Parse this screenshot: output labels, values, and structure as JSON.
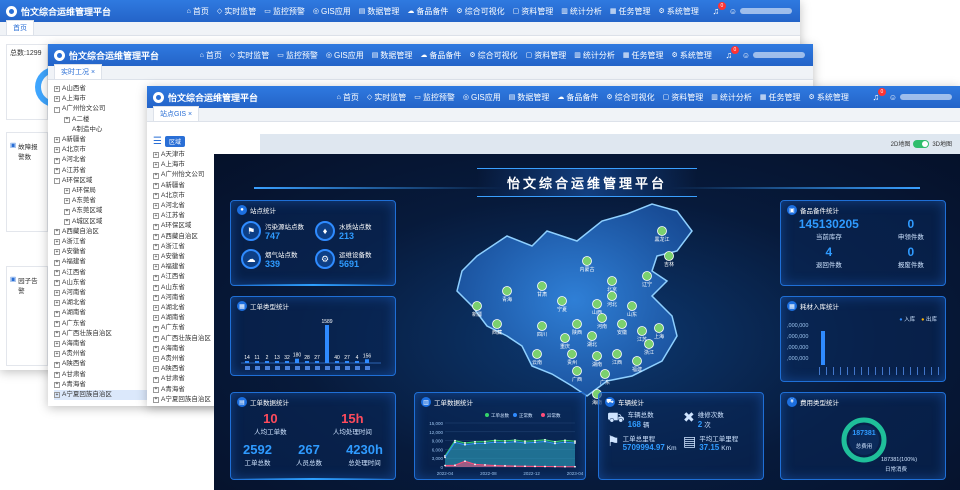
{
  "app_title": "怡文综合运维管理平台",
  "menu": [
    {
      "icon": "home-icon",
      "glyph": "⌂",
      "label": "首页"
    },
    {
      "icon": "shield-icon",
      "glyph": "◇",
      "label": "实时监管"
    },
    {
      "icon": "monitor-icon",
      "glyph": "▭",
      "label": "监控预警"
    },
    {
      "icon": "globe-icon",
      "glyph": "◎",
      "label": "GIS应用"
    },
    {
      "icon": "database-icon",
      "glyph": "▤",
      "label": "数据管理"
    },
    {
      "icon": "cloud-icon",
      "glyph": "☁",
      "label": "备品备件"
    },
    {
      "icon": "share-icon",
      "glyph": "⚙",
      "label": "综合可视化"
    },
    {
      "icon": "document-icon",
      "glyph": "▢",
      "label": "资料管理"
    },
    {
      "icon": "chart-icon",
      "glyph": "▥",
      "label": "统计分析"
    },
    {
      "icon": "task-icon",
      "glyph": "▦",
      "label": "任务管理"
    },
    {
      "icon": "gear-icon",
      "glyph": "⚙",
      "label": "系统管理"
    }
  ],
  "bell_count": "0",
  "win1": {
    "tab": "首页",
    "total_label": "总数:1299",
    "alarm_label": "故障报警数",
    "gas_label": "园子告警"
  },
  "win2": {
    "tab": "实时工况",
    "tree": [
      {
        "t": "A山西省",
        "b": "+",
        "d": 0
      },
      {
        "t": "A上海市",
        "b": "+",
        "d": 0
      },
      {
        "t": "A广州怡文公司",
        "b": "-",
        "d": 0
      },
      {
        "t": "A二楼",
        "b": "+",
        "d": 1
      },
      {
        "t": "A制造中心",
        "b": "",
        "d": 1
      },
      {
        "t": "A新疆省",
        "b": "+",
        "d": 0
      },
      {
        "t": "A北京市",
        "b": "+",
        "d": 0
      },
      {
        "t": "A河北省",
        "b": "+",
        "d": 0
      },
      {
        "t": "A江苏省",
        "b": "+",
        "d": 0
      },
      {
        "t": "A环保区域",
        "b": "-",
        "d": 0
      },
      {
        "t": "A环保局",
        "b": "+",
        "d": 1
      },
      {
        "t": "A东莞省",
        "b": "+",
        "d": 1
      },
      {
        "t": "A东莞区域",
        "b": "+",
        "d": 1
      },
      {
        "t": "A城区区域",
        "b": "+",
        "d": 1
      },
      {
        "t": "A西藏自治区",
        "b": "+",
        "d": 0
      },
      {
        "t": "A浙江省",
        "b": "+",
        "d": 0
      },
      {
        "t": "A安徽省",
        "b": "+",
        "d": 0
      },
      {
        "t": "A福建省",
        "b": "+",
        "d": 0
      },
      {
        "t": "A江西省",
        "b": "+",
        "d": 0
      },
      {
        "t": "A山东省",
        "b": "+",
        "d": 0
      },
      {
        "t": "A河南省",
        "b": "+",
        "d": 0
      },
      {
        "t": "A湖北省",
        "b": "+",
        "d": 0
      },
      {
        "t": "A湖南省",
        "b": "+",
        "d": 0
      },
      {
        "t": "A广东省",
        "b": "+",
        "d": 0
      },
      {
        "t": "A广西壮族自治区",
        "b": "+",
        "d": 0
      },
      {
        "t": "A海南省",
        "b": "+",
        "d": 0
      },
      {
        "t": "A贵州省",
        "b": "+",
        "d": 0
      },
      {
        "t": "A陕西省",
        "b": "+",
        "d": 0
      },
      {
        "t": "A甘肃省",
        "b": "+",
        "d": 0
      },
      {
        "t": "A青海省",
        "b": "+",
        "d": 0
      },
      {
        "t": "A宁夏回族自治区",
        "b": "+",
        "d": 0
      }
    ]
  },
  "win3": {
    "tab": "站点GIS",
    "region_btn": "区域",
    "map2d_label": "2D地图",
    "map3d_label": "3D地图",
    "tree": [
      "A天津市",
      "A上海市",
      "A广州怡文公司",
      "A新疆省",
      "A北京市",
      "A河北省",
      "A江苏省",
      "A环保区域",
      "A西藏自治区",
      "A浙江省",
      "A安徽省",
      "A福建省",
      "A江西省",
      "A山东省",
      "A河南省",
      "A湖北省",
      "A湖南省",
      "A广东省",
      "A广西壮族自治区",
      "A海南省",
      "A贵州省",
      "A陕西省",
      "A甘肃省",
      "A青海省",
      "A宁夏回族自治区"
    ]
  },
  "dashboard": {
    "title": "怡文综合运维管理平台",
    "site_panel": {
      "title": "站点统计",
      "items": [
        {
          "label": "污染源站点数",
          "value": "747"
        },
        {
          "label": "水质站点数",
          "value": "213"
        },
        {
          "label": "烟气站点数",
          "value": "339"
        },
        {
          "label": "运维设备数",
          "value": "5691"
        }
      ]
    },
    "type_panel": {
      "title": "工单类型统计"
    },
    "order_panel": {
      "title": "工单数据统计",
      "items": [
        {
          "value": "10",
          "label": "人均工单数",
          "color": "red"
        },
        {
          "value": "15h",
          "label": "人均处理时间",
          "color": "red"
        },
        {
          "value": "2592",
          "label": "工单总数",
          "color": "blue"
        },
        {
          "value": "267",
          "label": "人员总数",
          "color": "blue"
        },
        {
          "value": "4230h",
          "label": "总处理时间",
          "color": "blue"
        }
      ]
    },
    "trend_panel": {
      "title": "工单数据统计"
    },
    "vehicle_panel": {
      "title": "车辆统计",
      "items": [
        {
          "label": "车辆总数",
          "value": "168",
          "unit": "辆"
        },
        {
          "label": "维修次数",
          "value": "2",
          "unit": "次"
        },
        {
          "label": "工单总里程",
          "value": "5709994.97",
          "unit": "Km"
        },
        {
          "label": "平均工单里程",
          "value": "37.15",
          "unit": "Km"
        }
      ]
    },
    "spare_panel": {
      "title": "备品备件统计",
      "items": [
        {
          "value": "145130205",
          "label": "当前库存"
        },
        {
          "value": "0",
          "label": "申领件数"
        },
        {
          "value": "4",
          "label": "退回件数"
        },
        {
          "value": "0",
          "label": "报废件数"
        }
      ]
    },
    "inout_panel": {
      "title": "耗材入库统计",
      "legend": [
        "入库",
        "出库"
      ],
      "ticks": [
        ",000,000",
        ",000,000",
        ",000,000",
        ",000,000"
      ]
    },
    "cost_panel": {
      "title": "费用类型统计",
      "value": "187381",
      "sub": "总费用",
      "pct": "187381(100%)",
      "cat": "日常消费"
    },
    "map_labels": [
      "新疆",
      "西藏",
      "青海",
      "甘肃",
      "内蒙古",
      "黑龙江",
      "吉林",
      "辽宁",
      "北京",
      "河北",
      "山西",
      "山东",
      "河南",
      "陕西",
      "四川",
      "重庆",
      "湖北",
      "安徽",
      "江苏",
      "上海",
      "浙江",
      "湖南",
      "江西",
      "福建",
      "贵州",
      "云南",
      "广西",
      "广东",
      "海南",
      "宁夏"
    ]
  },
  "chart_data": [
    {
      "type": "bar",
      "title": "工单类型统计",
      "values": [
        14,
        11,
        2,
        13,
        32,
        180,
        28,
        27,
        1589,
        40,
        27,
        4,
        156
      ]
    },
    {
      "type": "area",
      "title": "工单数据统计",
      "x": [
        "2022-04",
        "2022-08",
        "2022-12",
        "2023-04"
      ],
      "ylim": [
        0,
        15000
      ],
      "yticks": [
        "15,000",
        "12,000",
        "9,000",
        "6,000",
        "3,000",
        "0"
      ],
      "series": [
        {
          "name": "工单总数",
          "color": "#35d46a",
          "values": [
            3800,
            9000,
            8200,
            8600,
            8700,
            9100,
            8900,
            9200,
            8800,
            9000,
            9300,
            8600,
            9100,
            8800
          ]
        },
        {
          "name": "正常数",
          "color": "#2f8bff",
          "values": [
            3300,
            8400,
            7600,
            8000,
            8100,
            8500,
            8300,
            8600,
            8200,
            8400,
            8700,
            8000,
            8500,
            8200
          ]
        },
        {
          "name": "异常数",
          "color": "#ff4d7a",
          "values": [
            500,
            600,
            2000,
            900,
            700,
            500,
            400,
            300,
            250,
            200,
            150,
            120,
            100,
            80
          ]
        }
      ]
    },
    {
      "type": "pie",
      "title": "费用类型统计",
      "series": [
        {
          "name": "日常消费",
          "values": [
            187381
          ]
        }
      ]
    }
  ]
}
